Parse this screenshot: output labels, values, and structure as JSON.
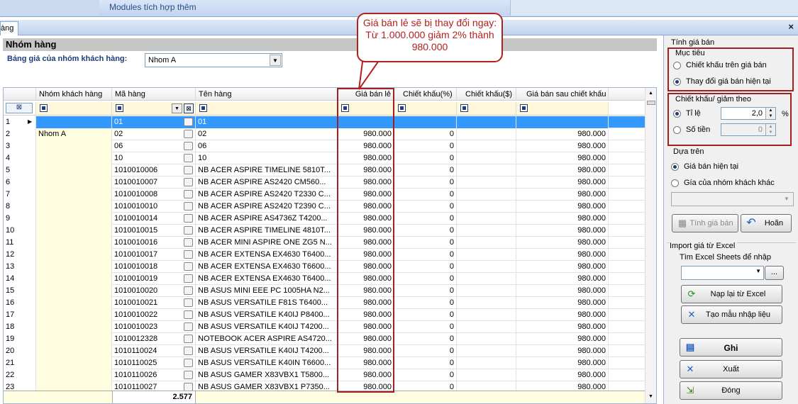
{
  "top": {
    "modules_label": "Modules tích hợp thêm"
  },
  "tab": {
    "label": "àng",
    "close": "×"
  },
  "page": {
    "title": "Nhóm hàng",
    "filter_label": "Bảng giá của nhóm khách hàng:",
    "group_value": "Nhom A"
  },
  "grid": {
    "headers": [
      "Nhóm khách hàng",
      "Mã hàng",
      "Tên hàng",
      "Giá bán lẻ",
      "Chiết khấu(%)",
      "Chiết khấu($)",
      "Giá bán sau chiết khấu"
    ],
    "rows": [
      [
        "1",
        "",
        "01",
        "01",
        "",
        "",
        "",
        ""
      ],
      [
        "2",
        "Nhom A",
        "02",
        "02",
        "980.000",
        "0",
        "",
        "980.000"
      ],
      [
        "3",
        "",
        "06",
        "06",
        "980.000",
        "0",
        "",
        "980.000"
      ],
      [
        "4",
        "",
        "10",
        "10",
        "980.000",
        "0",
        "",
        "980.000"
      ],
      [
        "5",
        "",
        "1010010006",
        "NB ACER ASPIRE TIMELINE 5810T...",
        "980.000",
        "0",
        "",
        "980.000"
      ],
      [
        "6",
        "",
        "1010010007",
        "NB ACER ASPIRE AS2420 CM560...",
        "980.000",
        "0",
        "",
        "980.000"
      ],
      [
        "7",
        "",
        "1010010008",
        "NB ACER ASPIRE AS2420 T2330 C...",
        "980.000",
        "0",
        "",
        "980.000"
      ],
      [
        "8",
        "",
        "1010010010",
        "NB ACER ASPIRE AS2420 T2390 C...",
        "980.000",
        "0",
        "",
        "980.000"
      ],
      [
        "9",
        "",
        "1010010014",
        "NB ACER ASPIRE AS4736Z T4200...",
        "980.000",
        "0",
        "",
        "980.000"
      ],
      [
        "10",
        "",
        "1010010015",
        "NB ACER ASPIRE TIMELINE 4810T...",
        "980.000",
        "0",
        "",
        "980.000"
      ],
      [
        "11",
        "",
        "1010010016",
        "NB ACER MINI ASPIRE ONE ZG5 N...",
        "980.000",
        "0",
        "",
        "980.000"
      ],
      [
        "12",
        "",
        "1010010017",
        "NB ACER EXTENSA EX4630 T6400...",
        "980.000",
        "0",
        "",
        "980.000"
      ],
      [
        "13",
        "",
        "1010010018",
        "NB ACER EXTENSA EX4630 T6600...",
        "980.000",
        "0",
        "",
        "980.000"
      ],
      [
        "14",
        "",
        "1010010019",
        "NB ACER EXTENSA EX4630 T6400...",
        "980.000",
        "0",
        "",
        "980.000"
      ],
      [
        "15",
        "",
        "1010010020",
        "NB ASUS MINI EEE PC 1005HA N2...",
        "980.000",
        "0",
        "",
        "980.000"
      ],
      [
        "16",
        "",
        "1010010021",
        "NB ASUS VERSATILE F81S T6400...",
        "980.000",
        "0",
        "",
        "980.000"
      ],
      [
        "17",
        "",
        "1010010022",
        "NB ASUS VERSATILE K40IJ P8400...",
        "980.000",
        "0",
        "",
        "980.000"
      ],
      [
        "18",
        "",
        "1010010023",
        "NB ASUS VERSATILE K40IJ T4200...",
        "980.000",
        "0",
        "",
        "980.000"
      ],
      [
        "19",
        "",
        "1010012328",
        "NOTEBOOK ACER ASPIRE AS4720...",
        "980.000",
        "0",
        "",
        "980.000"
      ],
      [
        "20",
        "",
        "1010110024",
        "NB ASUS VERSATILE K40IJ T4200...",
        "980.000",
        "0",
        "",
        "980.000"
      ],
      [
        "21",
        "",
        "1010110025",
        "NB ASUS VERSATILE K40IN T6600...",
        "980.000",
        "0",
        "",
        "980.000"
      ],
      [
        "22",
        "",
        "1010110026",
        "NB ASUS GAMER X83VBX1 T5800...",
        "980.000",
        "0",
        "",
        "980.000"
      ],
      [
        "23",
        "",
        "1010110027",
        "NB ASUS GAMER X83VBX1 P7350...",
        "980.000",
        "0",
        "",
        "980.000"
      ]
    ],
    "footer_count": "2.577"
  },
  "callout": {
    "text": "Giá bán lẻ sẽ bị thay đổi ngay: Từ 1.000.000 giảm 2% thành 980.000"
  },
  "panel": {
    "title": "Tính giá bán",
    "muc_tieu": "Mục tiêu",
    "opt_chietkhau": "Chiết khấu trên giá bán",
    "opt_thaydoi": "Thay đổi giá bán hiện tại",
    "ck_title": "Chiết khấu/ giảm theo",
    "opt_tile": "Tỉ lệ",
    "tile_value": "2,0",
    "percent": "%",
    "opt_sotien": "Số tiền",
    "sotien_value": "0",
    "dua_tren": "Dựa trên",
    "opt_giahientai": "Giá bán hiện tại",
    "opt_gianhom": "Gía của nhóm khách khác",
    "btn_tinh": "Tính giá bán",
    "btn_hoan": "Hoãn",
    "import_title": "Import giá từ Excel",
    "tim_excel": "Tìm Excel Sheets để nhập",
    "browse": "...",
    "btn_napl": "Nạp lại từ Excel",
    "btn_taomau": "Tạo mẫu nhập liệu",
    "btn_ghi": "Ghi",
    "btn_xuat": "Xuất",
    "btn_dong": "Đóng"
  },
  "colors": {
    "accent_red": "#b22020",
    "selection": "#3399ff",
    "group_fill": "#fffde0"
  }
}
